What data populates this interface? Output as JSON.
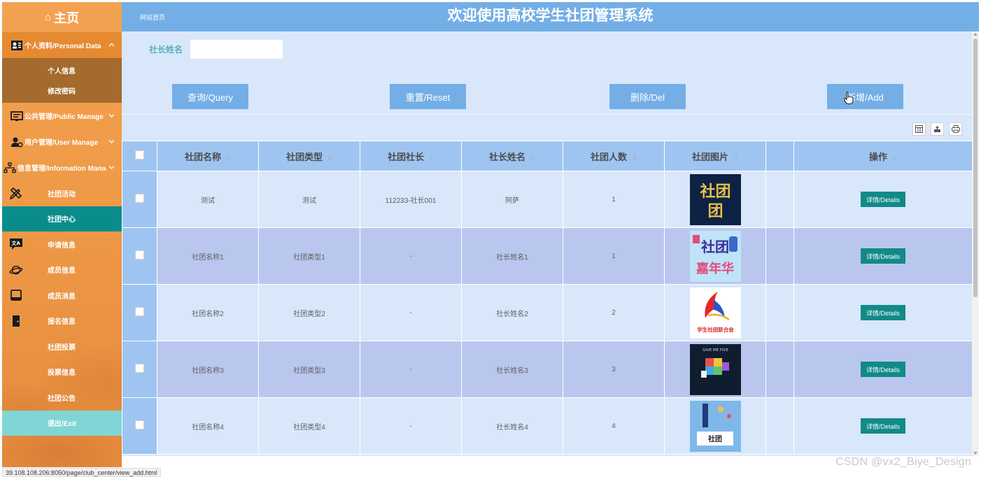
{
  "sidebar": {
    "home_label": "主页",
    "groups": {
      "personal": {
        "label": "个人资料/Personal Data",
        "sub": [
          "个人信息",
          "修改密码"
        ]
      },
      "public": {
        "label": "公共管理/Public Manage"
      },
      "user": {
        "label": "用户管理/User Manage"
      },
      "info": {
        "label": "信息管理/Information Manage"
      }
    },
    "items": [
      "社团活动",
      "社团中心",
      "申请信息",
      "成员信息",
      "成员消息",
      "报名信息",
      "社团投票",
      "投票信息",
      "社团公告",
      "退出/Exit"
    ],
    "active_item": "社团中心"
  },
  "header": {
    "home_link": "网站首页",
    "title": "欢迎使用高校学生社团管理系统"
  },
  "search": {
    "label": "社长姓名",
    "value": ""
  },
  "buttons": {
    "query": "查询/Query",
    "reset": "重置/Reset",
    "delete": "删除/Del",
    "add": "新增/Add"
  },
  "table": {
    "headers": [
      "社团名称",
      "社团类型",
      "社团社长",
      "社长姓名",
      "社团人数",
      "社团图片",
      "",
      "操作"
    ],
    "rows": [
      {
        "name": "测试",
        "type": "测试",
        "leader": "112233-社长001",
        "leader_name": "阿萨",
        "count": "1",
        "action": "详情/Details"
      },
      {
        "name": "社团名称1",
        "type": "社团类型1",
        "leader": "-",
        "leader_name": "社长姓名1",
        "count": "1",
        "action": "详情/Details"
      },
      {
        "name": "社团名称2",
        "type": "社团类型2",
        "leader": "-",
        "leader_name": "社长姓名2",
        "count": "2",
        "action": "详情/Details"
      },
      {
        "name": "社团名称3",
        "type": "社团类型3",
        "leader": "-",
        "leader_name": "社长姓名3",
        "count": "3",
        "action": "详情/Details"
      },
      {
        "name": "社团名称4",
        "type": "社团类型4",
        "leader": "-",
        "leader_name": "社长姓名4",
        "count": "4",
        "action": "详情/Details"
      }
    ],
    "images": {
      "img1_text": "社团",
      "img2_text": "社团嘉年华",
      "img3_text": "学生社团联合会",
      "img4_text": "GIVE ME FIVE",
      "img5_text": "社团"
    }
  },
  "status_url": "39.108.108.206:8050/page/club_center/view_add.html",
  "watermark": "CSDN @vx2_Biye_Design",
  "colors": {
    "header": "#74aee6",
    "main_bg": "#d9e7fb",
    "row_alt": "#b9c7ee",
    "sidebar": "#ef9a47",
    "active": "#0b8c8c",
    "exit": "#80d6d4"
  }
}
